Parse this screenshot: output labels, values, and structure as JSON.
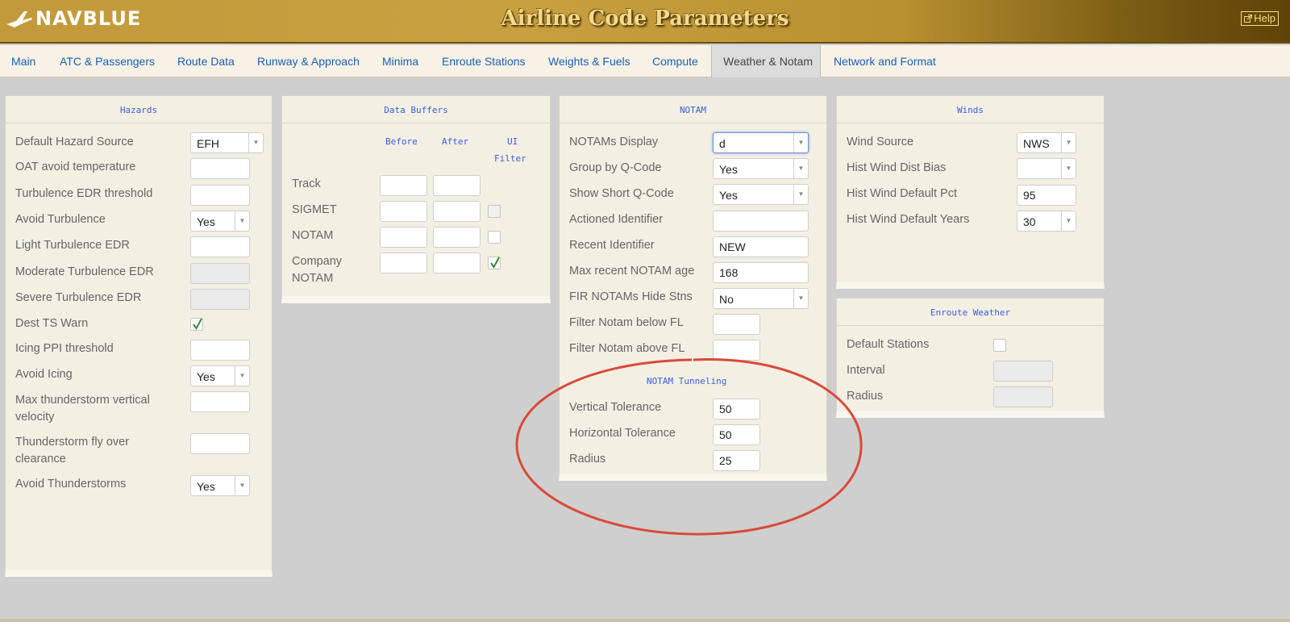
{
  "header": {
    "logo_text": "NAVBLUE",
    "app_title": "Airline Code Parameters",
    "help_label": "Help",
    "brand_color": "#c29a3b"
  },
  "tabs": [
    {
      "label": "Main"
    },
    {
      "label": "ATC & Passengers"
    },
    {
      "label": "Route Data"
    },
    {
      "label": "Runway & Approach"
    },
    {
      "label": "Minima"
    },
    {
      "label": "Enroute Stations"
    },
    {
      "label": "Weights & Fuels"
    },
    {
      "label": "Compute"
    },
    {
      "label": "Weather & Notam",
      "active": true
    },
    {
      "label": "Network and Format"
    }
  ],
  "hazards": {
    "title": "Hazards",
    "default_hazard_source": {
      "label": "Default Hazard Source",
      "value": "EFH"
    },
    "oat_avoid_temperature": {
      "label": "OAT avoid temperature",
      "value": ""
    },
    "turbulence_edr_threshold": {
      "label": "Turbulence EDR threshold",
      "value": ""
    },
    "avoid_turbulence": {
      "label": "Avoid Turbulence",
      "value": "Yes"
    },
    "light_turbulence_edr": {
      "label": "Light Turbulence EDR",
      "value": ""
    },
    "moderate_turbulence_edr": {
      "label": "Moderate Turbulence EDR",
      "value": ""
    },
    "severe_turbulence_edr": {
      "label": "Severe Turbulence EDR",
      "value": ""
    },
    "dest_ts_warn": {
      "label": "Dest TS Warn",
      "checked": true
    },
    "icing_ppi_threshold": {
      "label": "Icing PPI threshold",
      "value": ""
    },
    "avoid_icing": {
      "label": "Avoid Icing",
      "value": "Yes"
    },
    "max_thunderstorm_vv": {
      "label_line1": "Max thunderstorm vertical",
      "label_line2": "velocity",
      "value": ""
    },
    "thunderstorm_fly_over": {
      "label_line1": "Thunderstorm fly over",
      "label_line2": "clearance",
      "value": ""
    },
    "avoid_thunderstorms": {
      "label": "Avoid Thunderstorms",
      "value": "Yes"
    }
  },
  "data_buffers": {
    "title": "Data Buffers",
    "col_before": "Before",
    "col_after": "After",
    "col_ui": "UI",
    "col_filter": "Filter",
    "rows": [
      {
        "label": "Track",
        "before": "",
        "after": ""
      },
      {
        "label": "SIGMET",
        "before": "",
        "after": "",
        "ui_filter": false
      },
      {
        "label": "NOTAM",
        "before": "",
        "after": "",
        "ui_filter": false
      },
      {
        "label_line1": "Company",
        "label_line2": "NOTAM",
        "before": "",
        "after": "",
        "ui_filter": true
      }
    ]
  },
  "notam": {
    "title": "NOTAM",
    "notams_display": {
      "label": "NOTAMs Display",
      "value": "d"
    },
    "group_by_qcode": {
      "label": "Group by Q-Code",
      "value": "Yes"
    },
    "show_short_qcode": {
      "label": "Show Short Q-Code",
      "value": "Yes"
    },
    "actioned_identifier": {
      "label": "Actioned Identifier",
      "value": ""
    },
    "recent_identifier": {
      "label": "Recent Identifier",
      "value": "NEW"
    },
    "max_recent_notam_age": {
      "label": "Max recent NOTAM age",
      "value": "168"
    },
    "fir_notams_hide_stns": {
      "label": "FIR NOTAMs Hide Stns",
      "value": "No"
    },
    "filter_below_fl": {
      "label": "Filter Notam below FL",
      "value": ""
    },
    "filter_above_fl": {
      "label": "Filter Notam above FL",
      "value": ""
    },
    "tunneling_title": "NOTAM Tunneling",
    "vertical_tolerance": {
      "label": "Vertical Tolerance",
      "value": "50"
    },
    "horizontal_tolerance": {
      "label": "Horizontal Tolerance",
      "value": "50"
    },
    "radius": {
      "label": "Radius",
      "value": "25"
    }
  },
  "winds": {
    "title": "Winds",
    "wind_source": {
      "label": "Wind Source",
      "value": "NWS"
    },
    "hist_wind_dist_bias": {
      "label": "Hist Wind Dist Bias",
      "value": ""
    },
    "hist_wind_default_pct": {
      "label": "Hist Wind Default Pct",
      "value": "95"
    },
    "hist_wind_default_years": {
      "label": "Hist Wind Default Years",
      "value": "30"
    }
  },
  "enroute_weather": {
    "title": "Enroute Weather",
    "default_stations": {
      "label": "Default Stations",
      "checked": false
    },
    "interval": {
      "label": "Interval",
      "value": ""
    },
    "radius": {
      "label": "Radius",
      "value": ""
    }
  },
  "annotation": {
    "shape": "ellipse",
    "color": "#d94a3a"
  }
}
